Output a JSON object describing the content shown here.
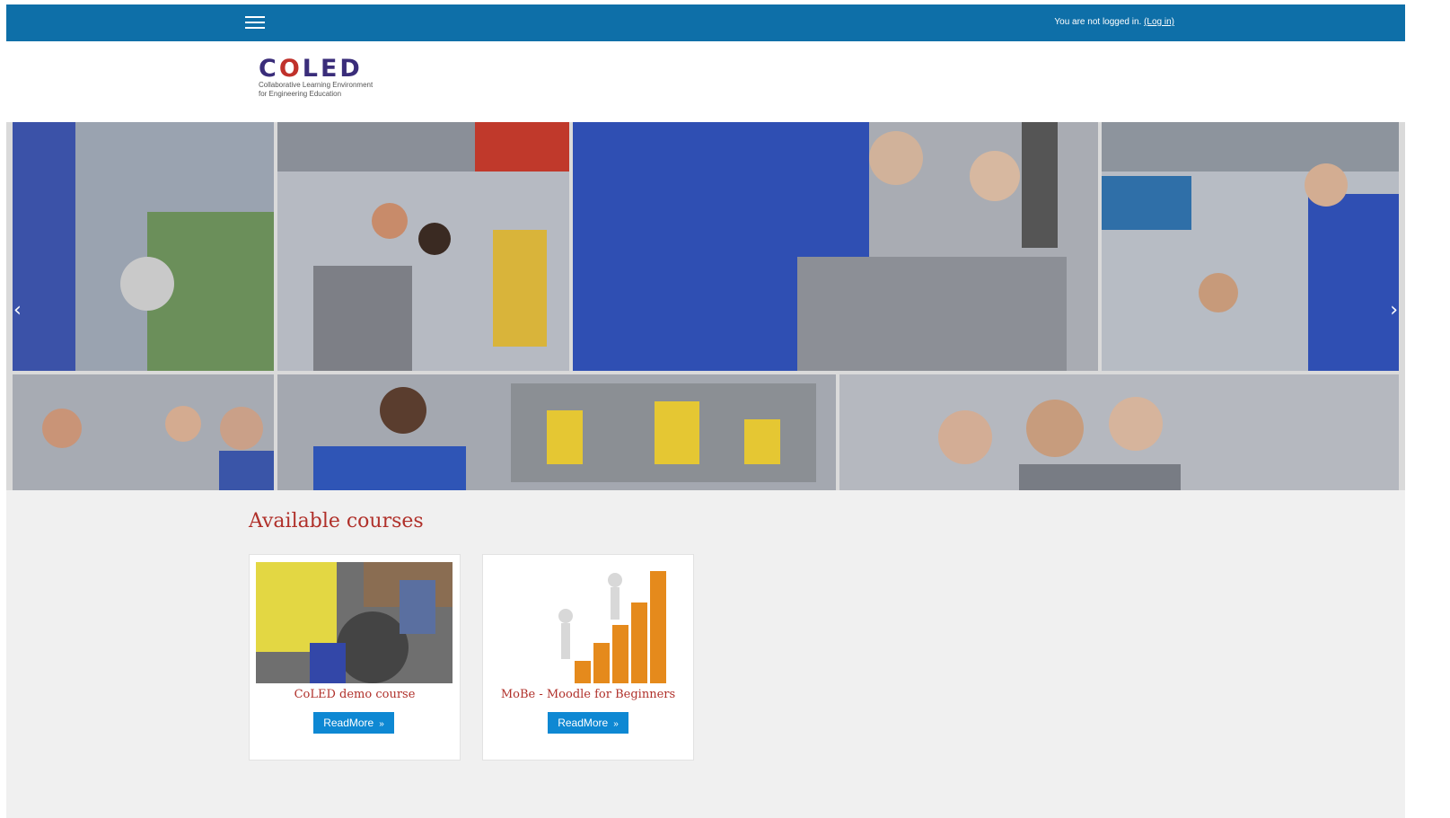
{
  "topbar": {
    "menu_icon": "hamburger-menu-icon",
    "login_text": "You are not logged in.",
    "login_link": "(Log in)",
    "bar_color": "#0e6fa8"
  },
  "logo": {
    "word_c": "C",
    "word_o": "O",
    "word_rest": "LED",
    "tagline_line1": "Collaborative Learning Environment",
    "tagline_line2": "for Engineering Education"
  },
  "slider": {
    "prev_icon": "chevron-left-icon",
    "next_icon": "chevron-right-icon",
    "prev_glyph": "‹",
    "next_glyph": "›"
  },
  "courses": {
    "title": "Available courses",
    "items": [
      {
        "title": "CoLED demo course",
        "button": "ReadMore",
        "chevron": "»"
      },
      {
        "title": "MoBe - Moodle for Beginners",
        "button": "ReadMore",
        "chevron": "»"
      }
    ]
  },
  "colors": {
    "accent": "#b0302a",
    "button": "#0e88d3"
  }
}
